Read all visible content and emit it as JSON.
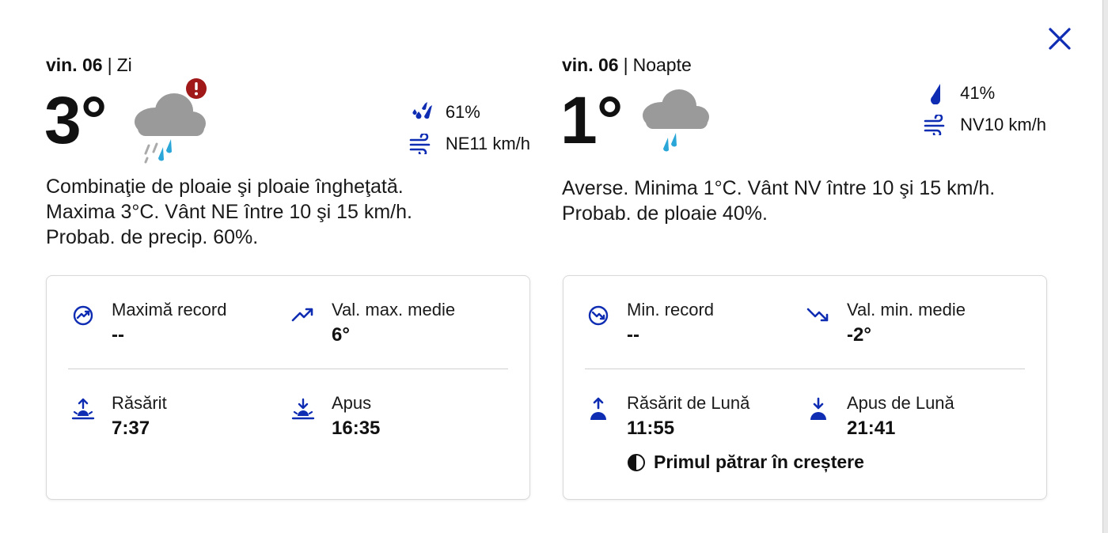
{
  "colors": {
    "accent": "#0f2db3",
    "rain_blue": "#2aa7d8",
    "alert_red": "#a01818",
    "cloud_gray": "#9a9a9a"
  },
  "close": {
    "icon": "close-icon"
  },
  "day": {
    "date": "vin. 06",
    "separator": "|",
    "period": "Zi",
    "temperature": "3°",
    "condition_icon": "cloud-rain-sleet-icon",
    "alert_icon": "alert-icon",
    "precip": {
      "icon": "precip-icon",
      "value": "61%"
    },
    "wind": {
      "icon": "wind-icon",
      "value": "NE11 km/h"
    },
    "summary": "Combinaţie de ploaie şi ploaie îngheţată. Maxima 3°C. Vânt NE între 10 şi 15 km/h. Probab. de precip. 60%.",
    "details": {
      "record": {
        "icon": "record-high-icon",
        "label": "Maximă record",
        "value": "--"
      },
      "average": {
        "icon": "trend-up-icon",
        "label": "Val. max. medie",
        "value": "6°"
      },
      "rise": {
        "icon": "sunrise-icon",
        "label": "Răsărit",
        "value": "7:37"
      },
      "set": {
        "icon": "sunset-icon",
        "label": "Apus",
        "value": "16:35"
      }
    }
  },
  "night": {
    "date": "vin. 06",
    "separator": "|",
    "period": "Noapte",
    "temperature": "1°",
    "condition_icon": "cloud-rain-icon",
    "precip": {
      "icon": "raindrop-icon",
      "value": "41%"
    },
    "wind": {
      "icon": "wind-icon",
      "value": "NV10 km/h"
    },
    "summary": "Averse. Minima 1°C. Vânt NV între 10 şi 15 km/h. Probab. de ploaie 40%.",
    "details": {
      "record": {
        "icon": "record-low-icon",
        "label": "Min. record",
        "value": "--"
      },
      "average": {
        "icon": "trend-down-icon",
        "label": "Val. min. medie",
        "value": "-2°"
      },
      "rise": {
        "icon": "moonrise-icon",
        "label": "Răsărit de Lună",
        "value": "11:55"
      },
      "set": {
        "icon": "moonset-icon",
        "label": "Apus de Lună",
        "value": "21:41"
      },
      "moon_phase": {
        "icon": "moon-phase-icon",
        "label": "Primul pătrar în creștere"
      }
    }
  }
}
